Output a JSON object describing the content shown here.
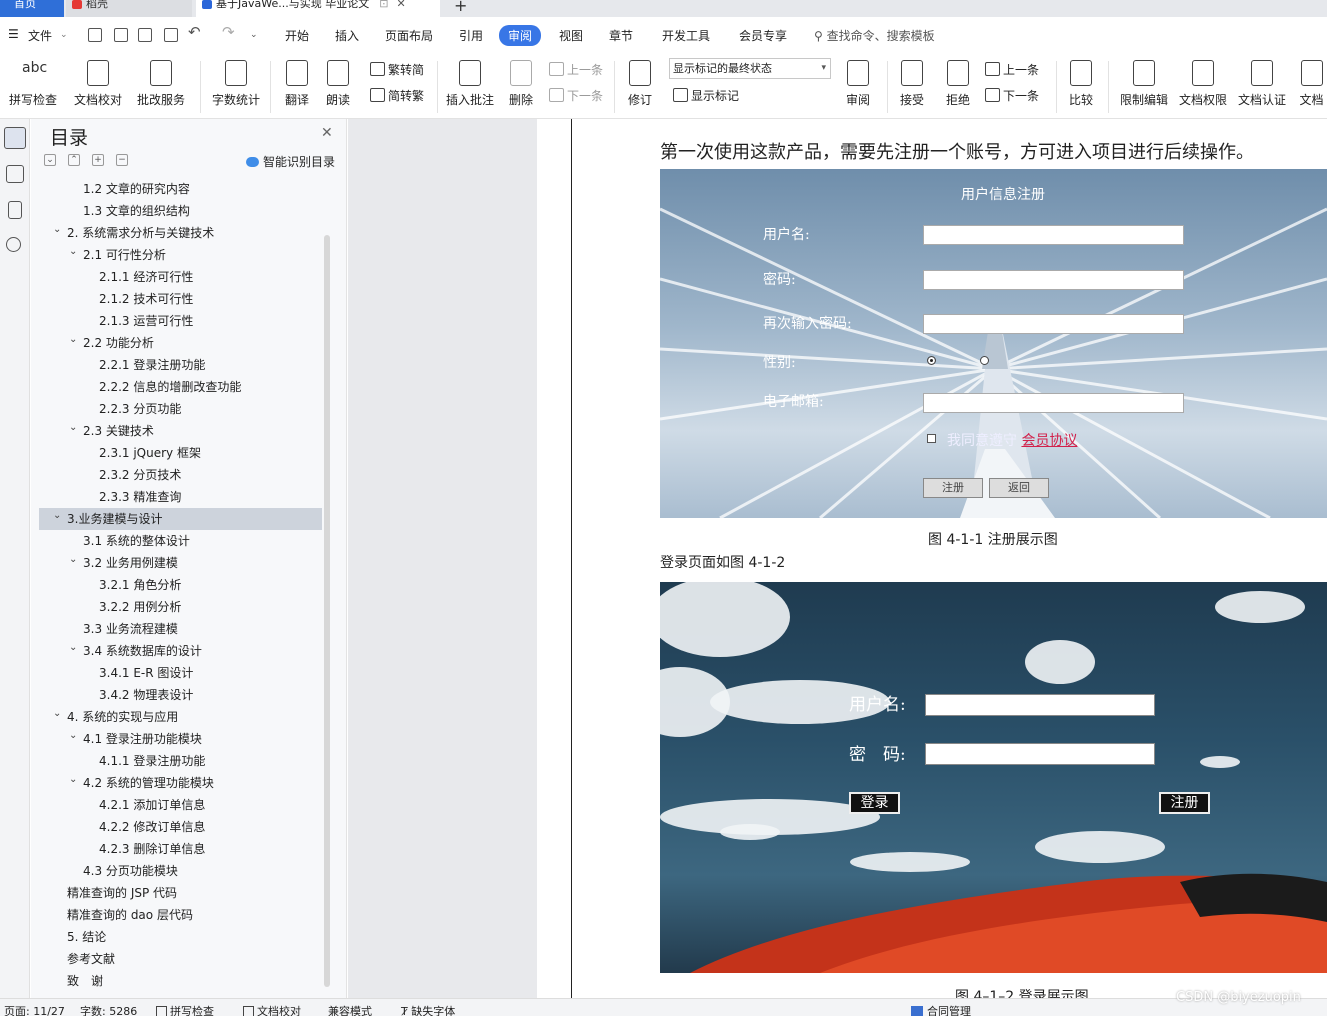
{
  "tabs": {
    "home": "首页",
    "daoke": "稻壳",
    "doc": "基于JavaWe...与实现 毕业论文",
    "add": "+"
  },
  "menu": {
    "file": "文件",
    "items": [
      "开始",
      "插入",
      "页面布局",
      "引用",
      "审阅",
      "视图",
      "章节",
      "开发工具",
      "会员专享"
    ],
    "search": "查找命令、搜索模板"
  },
  "ribbon": {
    "spell_check": "拼写检查",
    "doc_proof": "文档校对",
    "batch_service": "批改服务",
    "word_count": "字数统计",
    "translate": "翻译",
    "read_aloud": "朗读",
    "trad_to_simp": "繁转简",
    "simp_to_trad": "简转繁",
    "insert_comment": "插入批注",
    "delete": "删除",
    "prev_comment": "上一条",
    "next_comment": "下一条",
    "track_changes": "修订",
    "markup_select": "显示标记的最终状态",
    "show_markup": "显示标记",
    "review": "审阅",
    "accept": "接受",
    "reject": "拒绝",
    "prev_change": "上一条",
    "next_change": "下一条",
    "compare": "比较",
    "restrict_edit": "限制编辑",
    "doc_permission": "文档权限",
    "doc_certify": "文档认证",
    "doc_cut": "文档"
  },
  "toc": {
    "title": "目录",
    "smart": "智能识别目录",
    "items": [
      {
        "text": "1.2 文章的研究内容",
        "level": 2,
        "chevron": ""
      },
      {
        "text": "1.3 文章的组织结构",
        "level": 2,
        "chevron": ""
      },
      {
        "text": "2. 系统需求分析与关键技术",
        "level": 1,
        "chevron": "⌄"
      },
      {
        "text": "2.1 可行性分析",
        "level": 2,
        "chevron": "⌄"
      },
      {
        "text": "2.1.1 经济可行性",
        "level": 3,
        "chevron": ""
      },
      {
        "text": "2.1.2 技术可行性",
        "level": 3,
        "chevron": ""
      },
      {
        "text": "2.1.3 运营可行性",
        "level": 3,
        "chevron": ""
      },
      {
        "text": "2.2 功能分析",
        "level": 2,
        "chevron": "⌄"
      },
      {
        "text": "2.2.1 登录注册功能",
        "level": 3,
        "chevron": ""
      },
      {
        "text": "2.2.2 信息的增删改查功能",
        "level": 3,
        "chevron": ""
      },
      {
        "text": "2.2.3 分页功能",
        "level": 3,
        "chevron": ""
      },
      {
        "text": "2.3 关键技术",
        "level": 2,
        "chevron": "⌄"
      },
      {
        "text": "2.3.1 jQuery 框架",
        "level": 3,
        "chevron": ""
      },
      {
        "text": "2.3.2 分页技术",
        "level": 3,
        "chevron": ""
      },
      {
        "text": "2.3.3 精准查询",
        "level": 3,
        "chevron": ""
      },
      {
        "text": "3.业务建模与设计",
        "level": 1,
        "chevron": "⌄",
        "selected": true
      },
      {
        "text": "3.1 系统的整体设计",
        "level": 2,
        "chevron": ""
      },
      {
        "text": "3.2 业务用例建模",
        "level": 2,
        "chevron": "⌄"
      },
      {
        "text": "3.2.1 角色分析",
        "level": 3,
        "chevron": ""
      },
      {
        "text": "3.2.2 用例分析",
        "level": 3,
        "chevron": ""
      },
      {
        "text": "3.3 业务流程建模",
        "level": 2,
        "chevron": ""
      },
      {
        "text": "3.4 系统数据库的设计",
        "level": 2,
        "chevron": "⌄"
      },
      {
        "text": "3.4.1 E-R 图设计",
        "level": 3,
        "chevron": ""
      },
      {
        "text": "3.4.2 物理表设计",
        "level": 3,
        "chevron": ""
      },
      {
        "text": "4. 系统的实现与应用",
        "level": 1,
        "chevron": "⌄"
      },
      {
        "text": "4.1 登录注册功能模块",
        "level": 2,
        "chevron": "⌄"
      },
      {
        "text": "4.1.1 登录注册功能",
        "level": 3,
        "chevron": ""
      },
      {
        "text": "4.2 系统的管理功能模块",
        "level": 2,
        "chevron": "⌄"
      },
      {
        "text": "4.2.1 添加订单信息",
        "level": 3,
        "chevron": ""
      },
      {
        "text": "4.2.2 修改订单信息",
        "level": 3,
        "chevron": ""
      },
      {
        "text": "4.2.3 删除订单信息",
        "level": 3,
        "chevron": ""
      },
      {
        "text": "4.3 分页功能模块",
        "level": 2,
        "chevron": ""
      },
      {
        "text": "精准查询的 JSP 代码",
        "level": 1,
        "chevron": ""
      },
      {
        "text": "精准查询的 dao 层代码",
        "level": 1,
        "chevron": ""
      },
      {
        "text": "5. 结论",
        "level": 1,
        "chevron": ""
      },
      {
        "text": "参考文献",
        "level": 1,
        "chevron": ""
      },
      {
        "text": "致　谢",
        "level": 1,
        "chevron": ""
      }
    ]
  },
  "document": {
    "para1": "第一次使用这款产品，需要先注册一个账号，方可进入项目进行后续操作。",
    "fig1": {
      "title": "用户信息注册",
      "username": "用户名:",
      "password": "密码:",
      "confirm": "再次输入密码:",
      "gender": "性别:",
      "email": "电子邮箱:",
      "agree": "我同意遵守",
      "agree_link": "会员协议",
      "btn_register": "注册",
      "btn_back": "返回"
    },
    "caption1": "图 4-1-1 注册展示图",
    "para2": "登录页面如图 4-1-2",
    "fig2": {
      "username": "用户名:",
      "password": "密　码:",
      "btn_login": "登录",
      "btn_register": "注册"
    },
    "caption2": "图 4–1–2 登录展示图"
  },
  "status": {
    "page": "页面: 11/27",
    "words": "字数: 5286",
    "spell": "拼写检查",
    "proof": "文档校对",
    "compat": "兼容模式",
    "missing_font": "缺失字体",
    "contract": "合同管理"
  },
  "watermark": "CSDN @biyezuopin",
  "colors": {
    "accent": "#3876e6",
    "home_tab": "#2f6fd8",
    "link": "#d2214b"
  }
}
